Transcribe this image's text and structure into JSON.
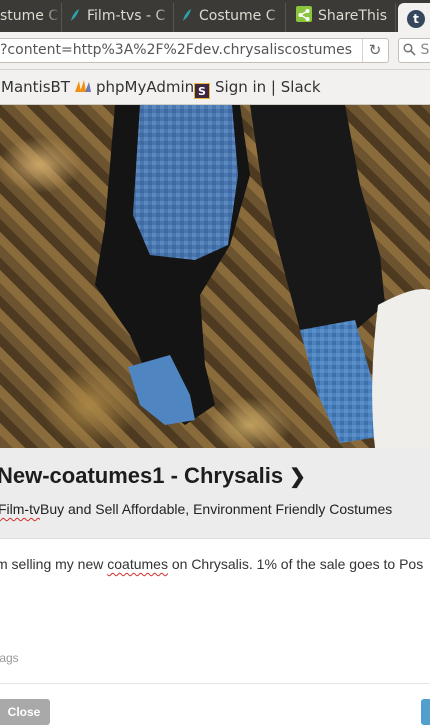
{
  "browser": {
    "tabs": [
      {
        "label": "stume C"
      },
      {
        "label": "Film-tvs - C"
      },
      {
        "label": "Costume C"
      },
      {
        "label": "ShareThis"
      },
      {
        "label": "t"
      }
    ],
    "url": "?content=http%3A%2F%2Fdev.chrysaliscostumes",
    "search_placeholder": "S",
    "bookmarks": [
      {
        "label": "MantisBT"
      },
      {
        "label": "phpMyAdmin"
      },
      {
        "label": "Sign in | Slack"
      }
    ]
  },
  "post": {
    "title": "New-coatumes1 - Chrysalis",
    "subtitle_tag": "Film-tv",
    "subtitle_rest": "Buy and Sell Affordable, Environment Friendly Costumes",
    "message_prefix": "m selling my new ",
    "message_misspelled": "coatumes",
    "message_suffix": " on Chrysalis. 1% of the sale goes to Pos",
    "tags_placeholder": "tags",
    "close_label": "Close"
  },
  "colors": {
    "tab_bar": "#3b3a36",
    "toolbar": "#f2f1f0",
    "card_background": "#ececec",
    "close_button": "#a9a9a9",
    "post_button": "#529ecc",
    "sharethis": "#8bc43f",
    "tumblr": "#36465d"
  }
}
